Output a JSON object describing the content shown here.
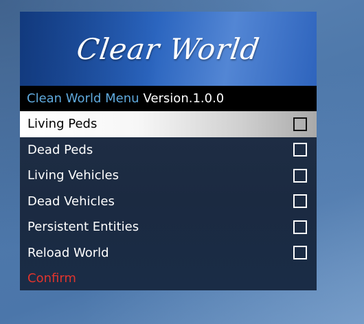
{
  "menu": {
    "title": "Clear World",
    "subtitle_name": "Clean World Menu",
    "subtitle_version": "Version.1.0.0",
    "items": [
      {
        "label": "Living Peds",
        "checked": false,
        "selected": true
      },
      {
        "label": "Dead Peds",
        "checked": false,
        "selected": false
      },
      {
        "label": "Living Vehicles",
        "checked": false,
        "selected": false
      },
      {
        "label": "Dead Vehicles",
        "checked": false,
        "selected": false
      },
      {
        "label": "Persistent Entities",
        "checked": false,
        "selected": false
      },
      {
        "label": "Reload World",
        "checked": false,
        "selected": false
      }
    ],
    "confirm_label": "Confirm"
  },
  "colors": {
    "banner": "#2b65bf",
    "subtitle_name": "#5fa9dc",
    "confirm": "#e0342d",
    "background": "#4f79ab"
  }
}
